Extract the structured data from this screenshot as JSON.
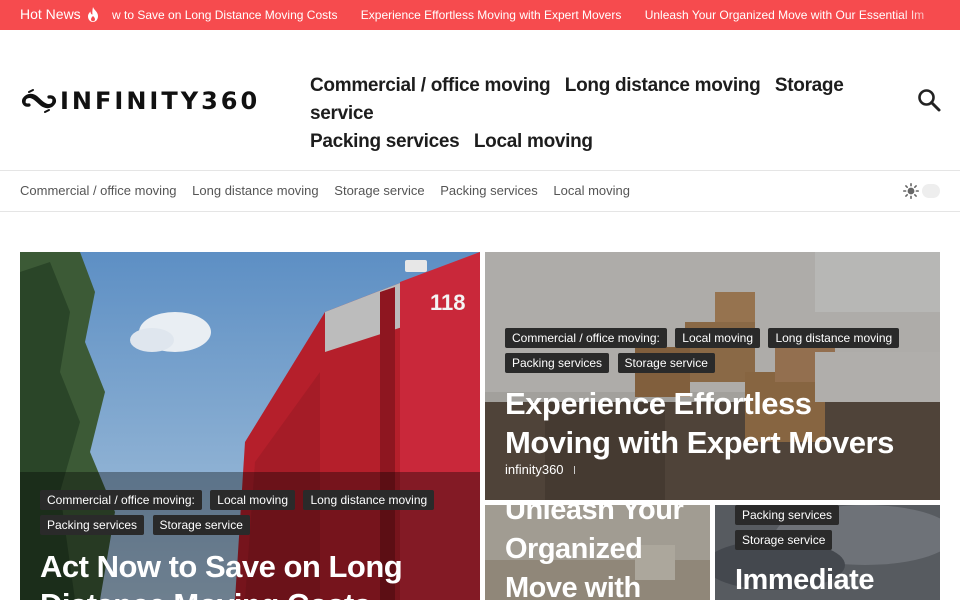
{
  "ticker": {
    "label": "Hot News",
    "items": [
      "w to Save on Long Distance Moving Costs",
      "Experience Effortless Moving with Expert Movers",
      "Unleash Your Organized Move with Our Essential Im"
    ],
    "color": "#f64b4e"
  },
  "header": {
    "brand": "INFINITY360",
    "nav": [
      "Commercial / office moving",
      "Long distance moving",
      "Storage service",
      "Packing services",
      "Local moving"
    ],
    "search_icon": "search-icon"
  },
  "subnav": {
    "links": [
      "Commercial / office moving",
      "Long distance moving",
      "Storage service",
      "Packing services",
      "Local moving"
    ],
    "theme_icon": "sun-icon"
  },
  "posts": [
    {
      "tags": [
        "Commercial / office moving:",
        "Local moving",
        "Long distance moving",
        "Packing services",
        "Storage service"
      ],
      "title": "Act Now to Save on Long Distance Moving Costs"
    },
    {
      "tags": [
        "Commercial / office moving:",
        "Local moving",
        "Long distance moving",
        "Packing services",
        "Storage service"
      ],
      "title": "Experience Effortless Moving with Expert Movers",
      "author": "infinity360"
    },
    {
      "title": "Unleash Your Organized Move with"
    },
    {
      "tags": [
        "Packing services",
        "Storage service"
      ],
      "title": "Immediate"
    }
  ]
}
